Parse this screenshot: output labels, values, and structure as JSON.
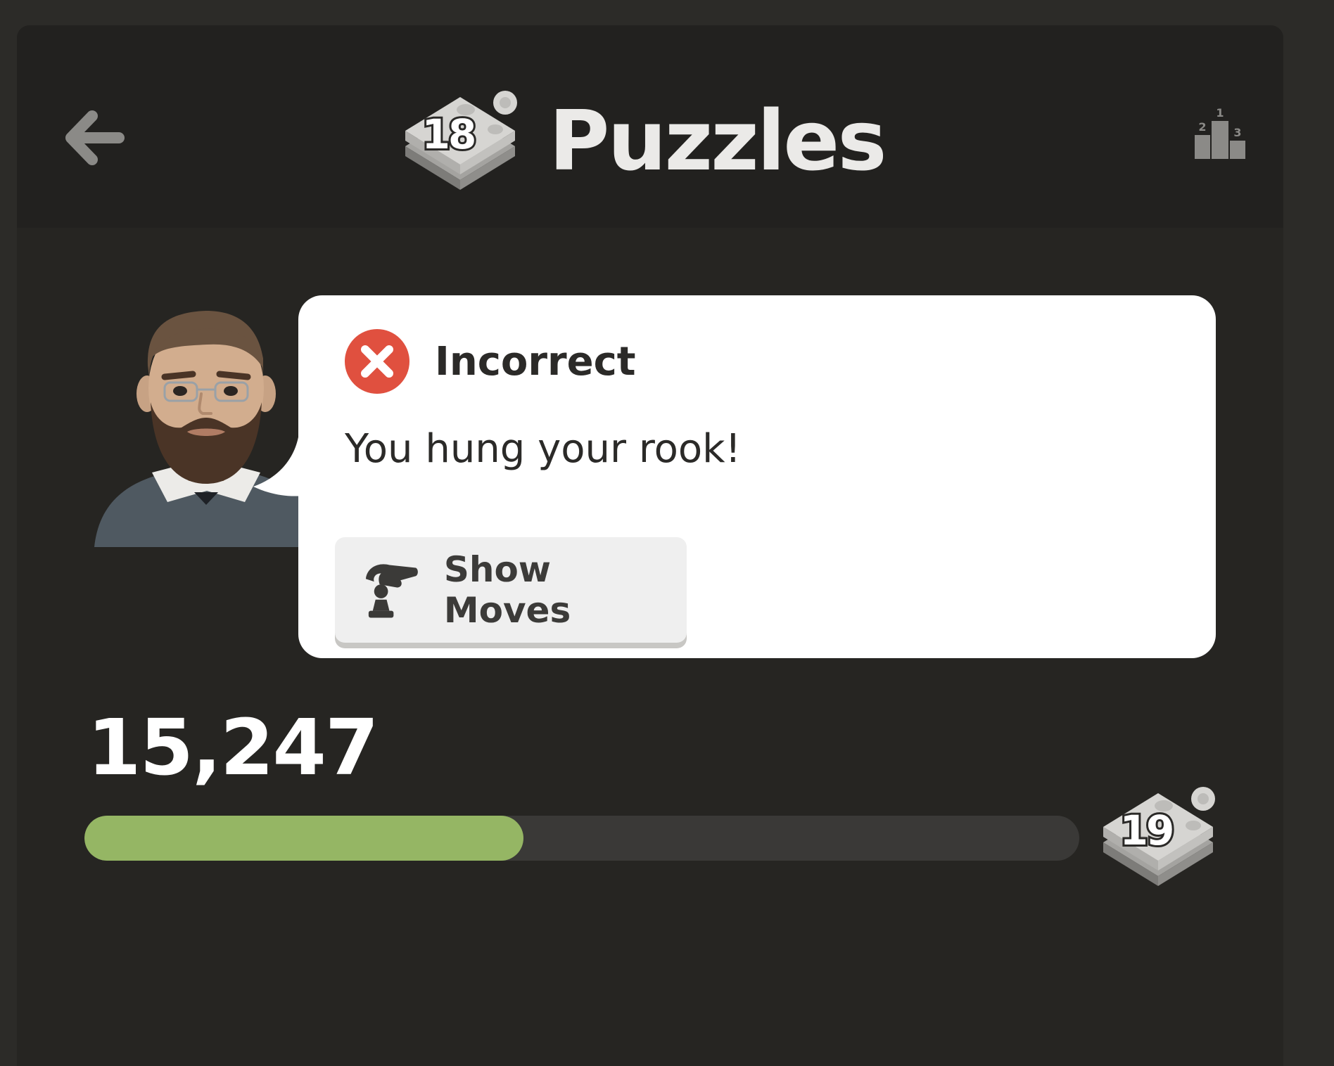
{
  "header": {
    "title": "Puzzles",
    "current_level": "18",
    "back_icon": "arrow-left-icon",
    "leaderboard_icon": "podium-icon"
  },
  "coach": {
    "avatar_icon": "coach-avatar"
  },
  "feedback": {
    "status_icon": "x-circle-icon",
    "status": "Incorrect",
    "message": "You hung your rook!",
    "show_moves_label": "Show Moves",
    "show_moves_icon": "hint-hand-pawn-icon"
  },
  "progress": {
    "score": "15,247",
    "fraction": 0.441,
    "next_level": "19"
  },
  "colors": {
    "background": "#2c2b28",
    "panel": "#262522",
    "header": "#22211f",
    "progress_fill": "#95b664",
    "progress_track": "#3a3937",
    "incorrect": "#e0503f"
  }
}
